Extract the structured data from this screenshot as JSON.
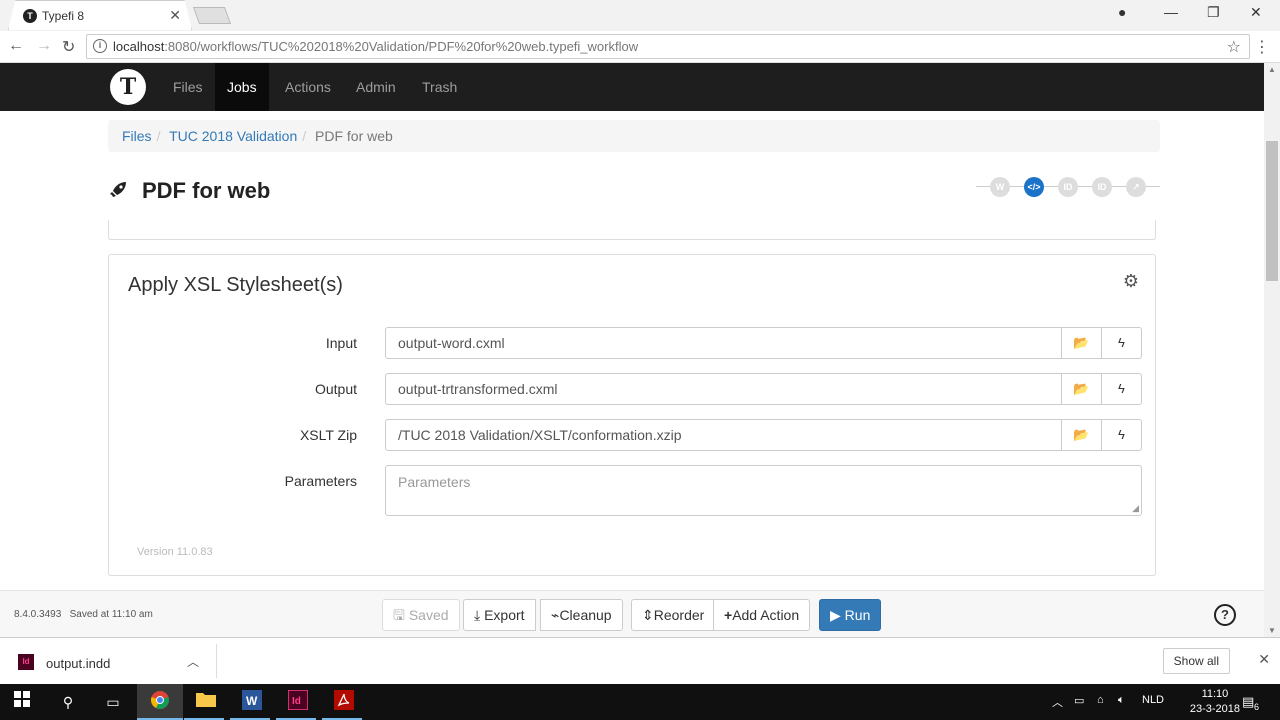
{
  "browser": {
    "tab_title": "Typefi 8",
    "url_host": "localhost",
    "url_rest": ":8080/workflows/TUC%202018%20Validation/PDF%20for%20web.typefi_workflow"
  },
  "nav": {
    "logo": "T",
    "items": [
      "Files",
      "Jobs",
      "Actions",
      "Admin",
      "Trash"
    ],
    "active": "Jobs"
  },
  "breadcrumb": [
    "Files",
    "TUC 2018 Validation",
    "PDF for web"
  ],
  "page": {
    "title": "PDF for web"
  },
  "steps": [
    {
      "label": "W",
      "active": false
    },
    {
      "label": "</>",
      "active": true
    },
    {
      "label": "ID",
      "active": false
    },
    {
      "label": "ID",
      "active": false
    },
    {
      "label": "↗",
      "active": false
    }
  ],
  "panel": {
    "title": "Apply XSL Stylesheet(s)",
    "fields": [
      {
        "label": "Input",
        "value": "output-word.cxml"
      },
      {
        "label": "Output",
        "value": "output-trtransformed.cxml"
      },
      {
        "label": "XSLT Zip",
        "value": "/TUC 2018 Validation/XSLT/conformation.xzip"
      }
    ],
    "parameters_label": "Parameters",
    "parameters_placeholder": "Parameters",
    "version": "Version 11.0.83"
  },
  "footer": {
    "build": "8.4.0.3493",
    "saved_status": "Saved at 11:10 am",
    "buttons": {
      "saved": "Saved",
      "export": "Export",
      "cleanup": "Cleanup",
      "reorder": "Reorder",
      "add_action": "Add Action",
      "run": "Run"
    }
  },
  "download": {
    "file": "output.indd",
    "show_all": "Show all"
  },
  "taskbar": {
    "lang": "NLD",
    "time": "11:10",
    "date": "23-3-2018",
    "notifications": "6"
  }
}
